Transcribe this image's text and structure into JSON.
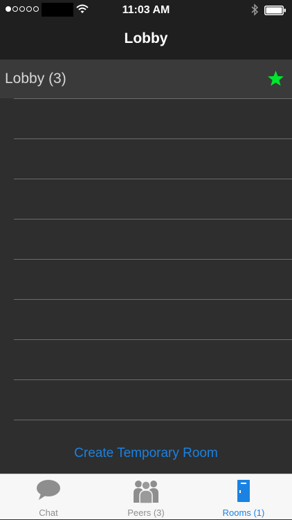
{
  "status_bar": {
    "time": "11:03 AM",
    "signal_filled": 1,
    "signal_total": 5
  },
  "nav": {
    "title": "Lobby"
  },
  "room": {
    "label": "Lobby",
    "count": "(3)",
    "star_color": "#00e62e",
    "star_icon": "star-icon"
  },
  "actions": {
    "create_room": "Create Temporary Room"
  },
  "tabs": [
    {
      "label": "Chat",
      "icon": "chat-bubble-icon",
      "active": false
    },
    {
      "label": "Peers (3)",
      "icon": "peers-icon",
      "active": false
    },
    {
      "label": "Rooms (1)",
      "icon": "rooms-icon",
      "active": true
    }
  ],
  "colors": {
    "accent": "#1a82e2",
    "background": "#2e2e2e",
    "bar": "#1f1f1f",
    "inactive_tab": "#8e8e8e"
  }
}
